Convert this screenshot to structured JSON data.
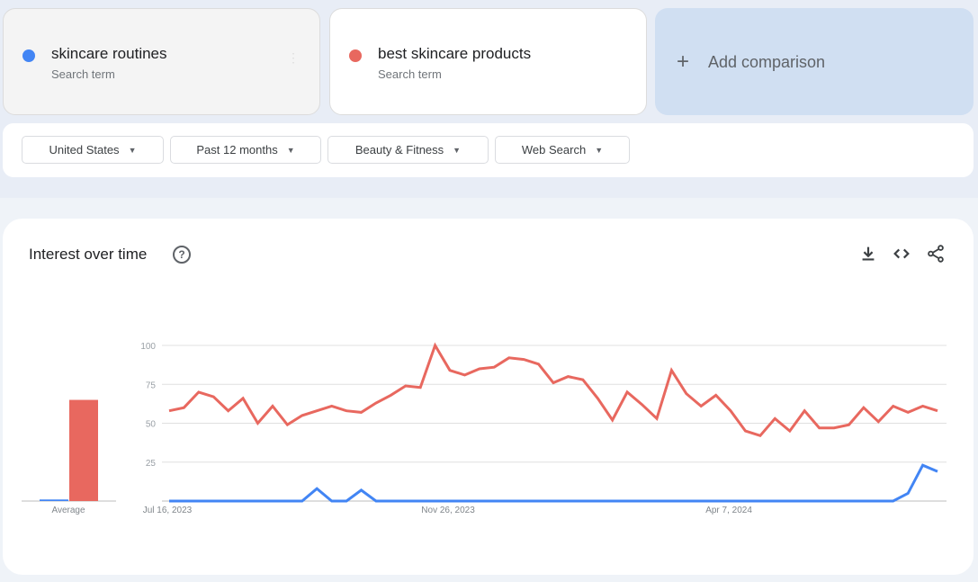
{
  "terms": [
    {
      "name": "skincare routines",
      "subtitle": "Search term",
      "color": "#4285f4"
    },
    {
      "name": "best skincare products",
      "subtitle": "Search term",
      "color": "#e8685f"
    }
  ],
  "add_comparison": {
    "label": "Add comparison",
    "icon": "plus-icon"
  },
  "filters": [
    {
      "label": "United States",
      "icon": "caret-down-icon"
    },
    {
      "label": "Past 12 months",
      "icon": "caret-down-icon"
    },
    {
      "label": "Beauty & Fitness",
      "icon": "caret-down-icon"
    },
    {
      "label": "Web Search",
      "icon": "caret-down-icon"
    }
  ],
  "card": {
    "title": "Interest over time",
    "help_icon": "?",
    "actions": [
      "download-icon",
      "embed-code-icon",
      "share-icon"
    ]
  },
  "chart_data": {
    "type": "line",
    "title": "Interest over time",
    "xlabel": "",
    "ylabel": "",
    "ylim": [
      0,
      100
    ],
    "yticks": [
      25,
      50,
      75,
      100
    ],
    "grid": true,
    "x_tick_labels": [
      {
        "index": 0,
        "label": "Jul 16, 2023"
      },
      {
        "index": 19,
        "label": "Nov 26, 2023"
      },
      {
        "index": 38,
        "label": "Apr 7, 2024"
      }
    ],
    "average": {
      "label": "Average",
      "values": [
        1,
        65
      ]
    },
    "series": [
      {
        "name": "skincare routines",
        "color": "#4285f4",
        "values": [
          0,
          0,
          0,
          0,
          0,
          0,
          0,
          0,
          0,
          0,
          8,
          0,
          0,
          7,
          0,
          0,
          0,
          0,
          0,
          0,
          0,
          0,
          0,
          0,
          0,
          0,
          0,
          0,
          0,
          0,
          0,
          0,
          0,
          0,
          0,
          0,
          0,
          0,
          0,
          0,
          0,
          0,
          0,
          0,
          0,
          0,
          0,
          0,
          0,
          0,
          5,
          23,
          19
        ]
      },
      {
        "name": "best skincare products",
        "color": "#e8685f",
        "values": [
          58,
          60,
          70,
          67,
          58,
          66,
          50,
          61,
          49,
          55,
          58,
          61,
          58,
          57,
          63,
          68,
          74,
          73,
          100,
          84,
          81,
          85,
          86,
          92,
          91,
          88,
          76,
          80,
          78,
          66,
          52,
          70,
          62,
          53,
          84,
          69,
          61,
          68,
          58,
          45,
          42,
          53,
          45,
          58,
          47,
          47,
          49,
          60,
          51,
          61,
          57,
          61,
          58
        ]
      }
    ]
  }
}
